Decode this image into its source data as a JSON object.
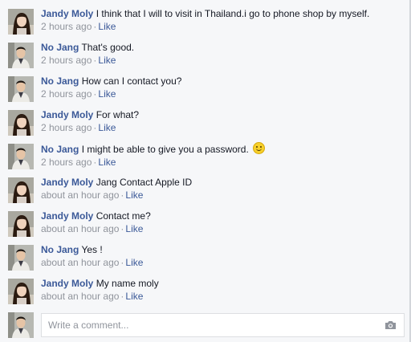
{
  "comments": [
    {
      "author": "Jandy Moly",
      "text": "I think that I will to visit in Thailand.i go to phone shop by myself.",
      "time": "2 hours ago",
      "like": "Like",
      "avatar": "female-avatar"
    },
    {
      "author": "No Jang",
      "text": "That's good.",
      "time": "2 hours ago",
      "like": "Like",
      "avatar": "male-avatar"
    },
    {
      "author": "No Jang",
      "text": "How can I contact you?",
      "time": "2 hours ago",
      "like": "Like",
      "avatar": "male-avatar"
    },
    {
      "author": "Jandy Moly",
      "text": "For what?",
      "time": "2 hours ago",
      "like": "Like",
      "avatar": "female-avatar"
    },
    {
      "author": "No Jang",
      "text": "I might be able to give you a password.",
      "time": "2 hours ago",
      "like": "Like",
      "avatar": "male-avatar",
      "emoji": "smile-emoji"
    },
    {
      "author": "Jandy Moly",
      "text": "Jang Contact Apple ID",
      "time": "about an hour ago",
      "like": "Like",
      "avatar": "female-avatar"
    },
    {
      "author": "Jandy Moly",
      "text": "Contact me?",
      "time": "about an hour ago",
      "like": "Like",
      "avatar": "female-avatar"
    },
    {
      "author": "No Jang",
      "text": "Yes !",
      "time": "about an hour ago",
      "like": "Like",
      "avatar": "male-avatar"
    },
    {
      "author": "Jandy Moly",
      "text": "My name moly",
      "time": "about an hour ago",
      "like": "Like",
      "avatar": "female-avatar"
    }
  ],
  "composer": {
    "placeholder": "Write a comment...",
    "camera_icon": "camera-icon",
    "avatar": "male-avatar"
  },
  "separator": "·",
  "colors": {
    "link": "#3b5998",
    "meta": "#90949c",
    "text": "#141823",
    "background": "#f6f7f9"
  }
}
